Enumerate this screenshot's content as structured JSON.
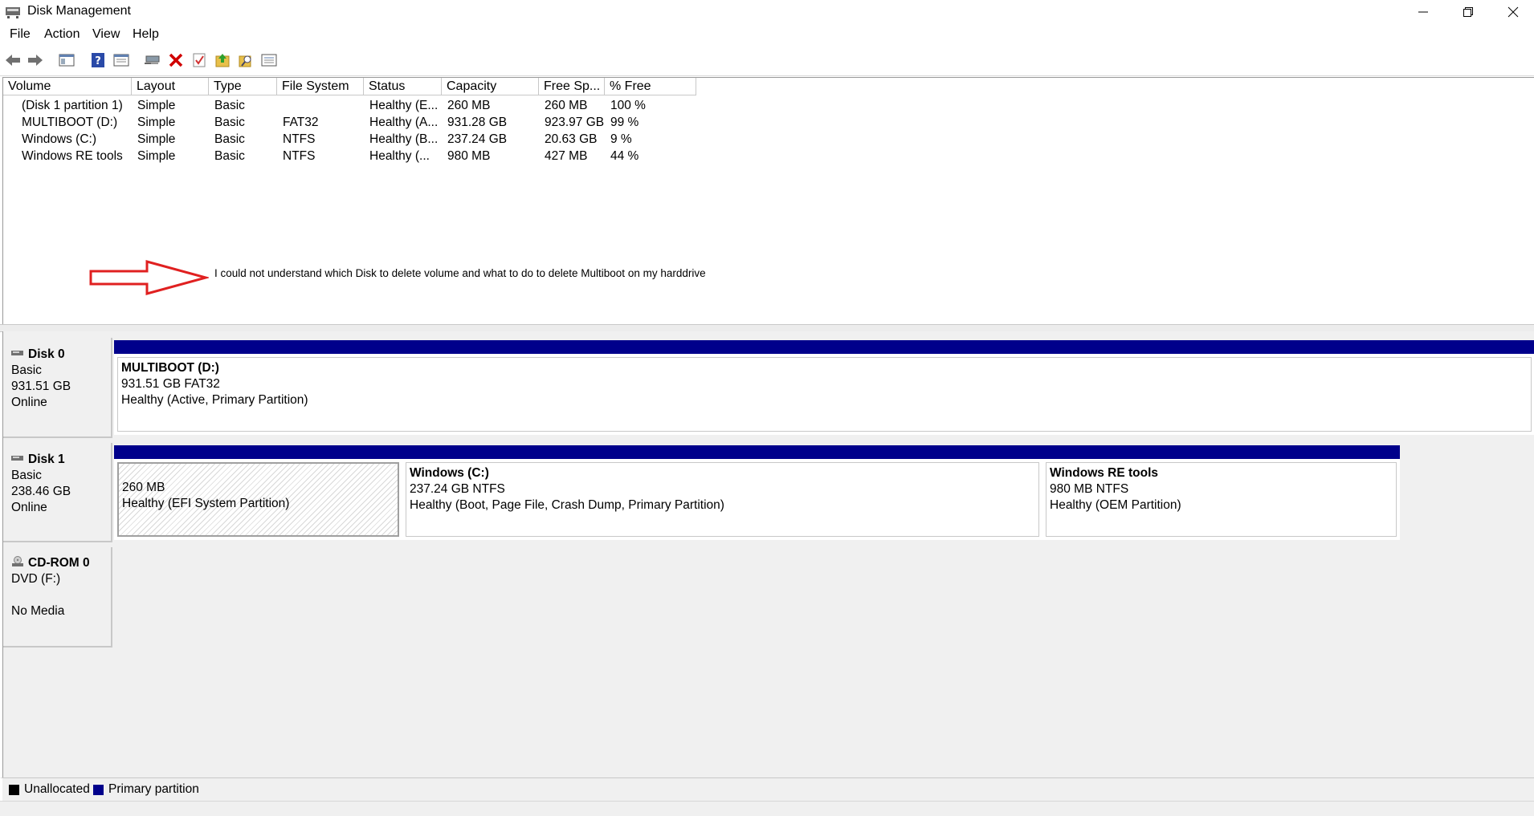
{
  "window": {
    "title": "Disk Management",
    "icon": "disk-management-icon"
  },
  "menu": [
    "File",
    "Action",
    "View",
    "Help"
  ],
  "toolbar": {
    "icons": [
      "back-icon",
      "forward-icon",
      "console-tree-icon",
      "help-icon",
      "properties-icon",
      "connect-icon",
      "delete-icon",
      "check-icon",
      "export-icon",
      "search-icon",
      "list-icon"
    ],
    "delete_color": "#d00000"
  },
  "volume_table": {
    "columns": [
      "Volume",
      "Layout",
      "Type",
      "File System",
      "Status",
      "Capacity",
      "Free Sp...",
      "% Free"
    ],
    "rows": [
      {
        "volume": "(Disk 1 partition 1)",
        "layout": "Simple",
        "type": "Basic",
        "fs": "",
        "status": "Healthy (E...",
        "capacity": "260 MB",
        "free": "260 MB",
        "pct": "100 %"
      },
      {
        "volume": "MULTIBOOT (D:)",
        "layout": "Simple",
        "type": "Basic",
        "fs": "FAT32",
        "status": "Healthy (A...",
        "capacity": "931.28 GB",
        "free": "923.97 GB",
        "pct": "99 %"
      },
      {
        "volume": "Windows (C:)",
        "layout": "Simple",
        "type": "Basic",
        "fs": "NTFS",
        "status": "Healthy (B...",
        "capacity": "237.24 GB",
        "free": "20.63 GB",
        "pct": "9 %"
      },
      {
        "volume": "Windows RE tools",
        "layout": "Simple",
        "type": "Basic",
        "fs": "NTFS",
        "status": "Healthy (...",
        "capacity": "980 MB",
        "free": "427 MB",
        "pct": "44 %"
      }
    ]
  },
  "annotation": {
    "text": "I could not understand which Disk to delete volume and what to do to delete Multiboot on my harddrive",
    "arrow_color": "#e02020"
  },
  "disks": [
    {
      "name": "Disk 0",
      "kind": "Basic",
      "size": "931.51 GB",
      "state": "Online",
      "partitions": [
        {
          "name": "MULTIBOOT  (D:)",
          "size": "931.51 GB FAT32",
          "status": "Healthy (Active, Primary Partition)"
        }
      ]
    },
    {
      "name": "Disk 1",
      "kind": "Basic",
      "size": "238.46 GB",
      "state": "Online",
      "partitions": [
        {
          "name": "",
          "size": "260 MB",
          "status": "Healthy (EFI System Partition)"
        },
        {
          "name": "Windows  (C:)",
          "size": "237.24 GB NTFS",
          "status": "Healthy (Boot, Page File, Crash Dump, Primary Partition)"
        },
        {
          "name": "Windows RE tools",
          "size": "980 MB NTFS",
          "status": "Healthy (OEM Partition)"
        }
      ]
    },
    {
      "name": "CD-ROM 0",
      "kind": "DVD (F:)",
      "size": "",
      "state": "No Media"
    }
  ],
  "legend": {
    "items": [
      {
        "label": "Unallocated",
        "color": "#000000"
      },
      {
        "label": "Primary partition",
        "color": "#00008b"
      }
    ]
  }
}
